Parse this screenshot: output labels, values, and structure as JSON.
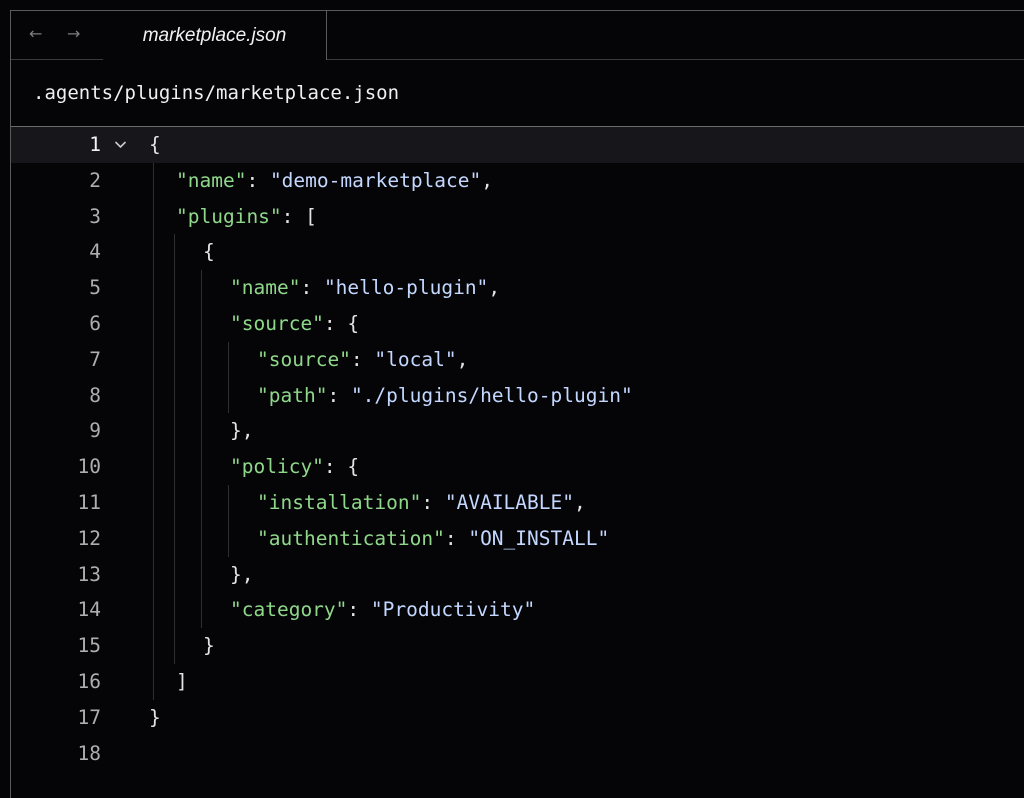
{
  "nav": {
    "back_label": "←",
    "forward_label": "→"
  },
  "tab": {
    "label": "marketplace.json"
  },
  "file_path": ".agents/plugins/marketplace.json",
  "fold_icon": "chevron-down-icon",
  "colors": {
    "key": "#8fd88a",
    "string": "#c4d8ff",
    "punctuation": "#e4e4e4",
    "background": "#050508"
  },
  "lines": [
    {
      "n": "1",
      "indent": 0,
      "tokens": [
        {
          "t": "{",
          "c": "p"
        }
      ],
      "fold": true,
      "current": true
    },
    {
      "n": "2",
      "indent": 1,
      "tokens": [
        {
          "t": "\"name\"",
          "c": "k"
        },
        {
          "t": ": ",
          "c": "p"
        },
        {
          "t": "\"demo-marketplace\"",
          "c": "s"
        },
        {
          "t": ",",
          "c": "p"
        }
      ]
    },
    {
      "n": "3",
      "indent": 1,
      "tokens": [
        {
          "t": "\"plugins\"",
          "c": "k"
        },
        {
          "t": ": [",
          "c": "p"
        }
      ]
    },
    {
      "n": "4",
      "indent": 2,
      "tokens": [
        {
          "t": "{",
          "c": "p"
        }
      ]
    },
    {
      "n": "5",
      "indent": 3,
      "tokens": [
        {
          "t": "\"name\"",
          "c": "k"
        },
        {
          "t": ": ",
          "c": "p"
        },
        {
          "t": "\"hello-plugin\"",
          "c": "s"
        },
        {
          "t": ",",
          "c": "p"
        }
      ]
    },
    {
      "n": "6",
      "indent": 3,
      "tokens": [
        {
          "t": "\"source\"",
          "c": "k"
        },
        {
          "t": ": {",
          "c": "p"
        }
      ]
    },
    {
      "n": "7",
      "indent": 4,
      "tokens": [
        {
          "t": "\"source\"",
          "c": "k"
        },
        {
          "t": ": ",
          "c": "p"
        },
        {
          "t": "\"local\"",
          "c": "s"
        },
        {
          "t": ",",
          "c": "p"
        }
      ]
    },
    {
      "n": "8",
      "indent": 4,
      "tokens": [
        {
          "t": "\"path\"",
          "c": "k"
        },
        {
          "t": ": ",
          "c": "p"
        },
        {
          "t": "\"./plugins/hello-plugin\"",
          "c": "s"
        }
      ]
    },
    {
      "n": "9",
      "indent": 3,
      "tokens": [
        {
          "t": "},",
          "c": "p"
        }
      ]
    },
    {
      "n": "10",
      "indent": 3,
      "tokens": [
        {
          "t": "\"policy\"",
          "c": "k"
        },
        {
          "t": ": {",
          "c": "p"
        }
      ]
    },
    {
      "n": "11",
      "indent": 4,
      "tokens": [
        {
          "t": "\"installation\"",
          "c": "k"
        },
        {
          "t": ": ",
          "c": "p"
        },
        {
          "t": "\"AVAILABLE\"",
          "c": "s"
        },
        {
          "t": ",",
          "c": "p"
        }
      ]
    },
    {
      "n": "12",
      "indent": 4,
      "tokens": [
        {
          "t": "\"authentication\"",
          "c": "k"
        },
        {
          "t": ": ",
          "c": "p"
        },
        {
          "t": "\"ON_INSTALL\"",
          "c": "s"
        }
      ]
    },
    {
      "n": "13",
      "indent": 3,
      "tokens": [
        {
          "t": "},",
          "c": "p"
        }
      ]
    },
    {
      "n": "14",
      "indent": 3,
      "tokens": [
        {
          "t": "\"category\"",
          "c": "k"
        },
        {
          "t": ": ",
          "c": "p"
        },
        {
          "t": "\"Productivity\"",
          "c": "s"
        }
      ]
    },
    {
      "n": "15",
      "indent": 2,
      "tokens": [
        {
          "t": "}",
          "c": "p"
        }
      ]
    },
    {
      "n": "16",
      "indent": 1,
      "tokens": [
        {
          "t": "]",
          "c": "p"
        }
      ]
    },
    {
      "n": "17",
      "indent": 0,
      "tokens": [
        {
          "t": "}",
          "c": "p"
        }
      ]
    },
    {
      "n": "18",
      "indent": 0,
      "tokens": []
    }
  ]
}
